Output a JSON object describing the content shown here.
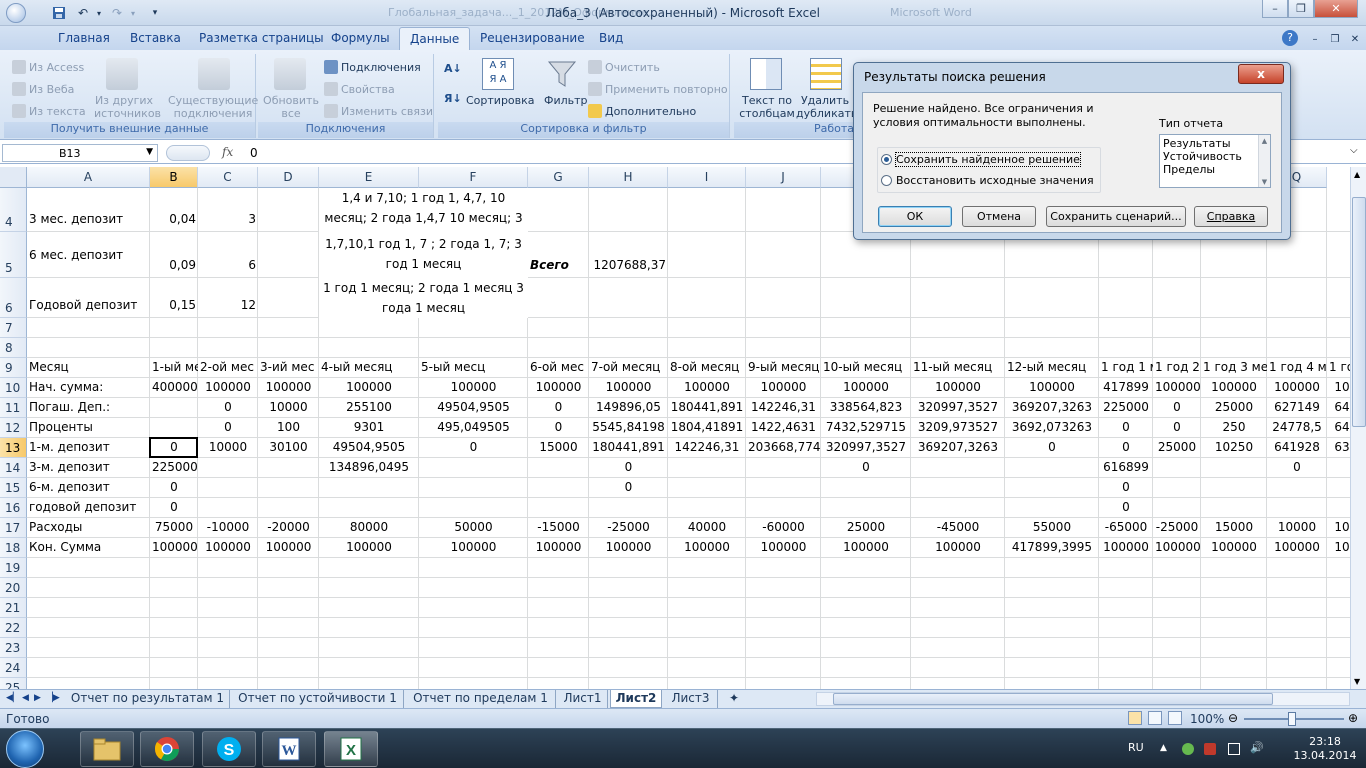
{
  "window": {
    "title": "Лаба_3 (Автосохраненный) - Microsoft Excel",
    "ghost_left": "Глобальная_задача..._1_2012М_Оформление...",
    "ghost_right": "Microsoft Word"
  },
  "ribbon": {
    "tabs": [
      "Главная",
      "Вставка",
      "Разметка страницы",
      "Формулы",
      "Данные",
      "Рецензирование",
      "Вид"
    ],
    "active_tab": "Данные",
    "groups": {
      "external": {
        "label": "Получить внешние данные",
        "from_access": "Из Access",
        "from_web": "Из Веба",
        "from_text": "Из текста",
        "from_other_1": "Из других",
        "from_other_2": "источников",
        "existing_1": "Существующие",
        "existing_2": "подключения"
      },
      "connections": {
        "label": "Подключения",
        "refresh_1": "Обновить",
        "refresh_2": "все",
        "connections": "Подключения",
        "properties": "Свойства",
        "edit_links": "Изменить связи"
      },
      "sort": {
        "label": "Сортировка и фильтр",
        "sort": "Сортировка",
        "filter": "Фильтр",
        "clear": "Очистить",
        "reapply": "Применить повторно",
        "advanced": "Дополнительно"
      },
      "tools": {
        "label": "Работа",
        "text_to_cols_1": "Текст по",
        "text_to_cols_2": "столбцам",
        "remove_dup_1": "Удалить",
        "remove_dup_2": "дубликаты"
      }
    }
  },
  "formula_bar": {
    "name_box": "B13",
    "fx": "fx",
    "value": "0"
  },
  "grid": {
    "columns": [
      "A",
      "B",
      "C",
      "D",
      "E",
      "F",
      "G",
      "H",
      "I",
      "J",
      "K",
      "L",
      "M",
      "N",
      "O",
      "P",
      "Q"
    ],
    "rows": [
      "4",
      "5",
      "6",
      "7",
      "8",
      "9",
      "10",
      "11",
      "12",
      "13",
      "14",
      "15",
      "16",
      "17",
      "18",
      "19",
      "20",
      "21",
      "22",
      "23",
      "24",
      "25"
    ],
    "top_notes": {
      "a4": "3 мес. депозит",
      "b4": "0,04",
      "c4": "3",
      "e4": "1,4 и 7,10; 1 год 1, 4,7, 10 месяц; 2 года 1,4,7 10 месяц; 3 года 1",
      "a5": "6 мес. депозит",
      "b5": "0,09",
      "c5": "6",
      "e5": "1,7,10,1 год 1, 7 ; 2 года 1, 7; 3 год 1 месяц",
      "g5": "Всего",
      "h5": "1207688,37",
      "a6": "Годовой депозит",
      "b6": "0,15",
      "c6": "12",
      "e6": "1 год 1 месяц; 2 года 1 месяц 3 года 1 месяц"
    },
    "table_rows": [
      [
        "Месяц",
        "1-ый мес",
        "2-ой мес",
        "3-ий мес",
        "4-ый месяц",
        "5-ый месц",
        "6-ой мес",
        "7-ой месяц",
        "8-ой месяц",
        "9-ый месяц",
        "10-ый месяц",
        "11-ый месяц",
        "12-ый месяц",
        "1 год 1 м",
        "1 год 2",
        "1 год 3 ме",
        "1 год 4 ме",
        "1 го"
      ],
      [
        "Нач. сумма:",
        "400000",
        "100000",
        "100000",
        "100000",
        "100000",
        "100000",
        "100000",
        "100000",
        "100000",
        "100000",
        "100000",
        "100000",
        "417899",
        "100000",
        "100000",
        "100000",
        "10"
      ],
      [
        "Погаш. Деп.:",
        "",
        "0",
        "10000",
        "255100",
        "49504,9505",
        "0",
        "149896,05",
        "180441,891",
        "142246,31",
        "338564,823",
        "320997,3527",
        "369207,3263",
        "225000",
        "0",
        "25000",
        "627149",
        "64"
      ],
      [
        "Проценты",
        "",
        "0",
        "100",
        "9301",
        "495,049505",
        "0",
        "5545,84198",
        "1804,41891",
        "1422,4631",
        "7432,529715",
        "3209,973527",
        "3692,073263",
        "0",
        "0",
        "250",
        "24778,5",
        "64"
      ],
      [
        "1-м. депозит",
        "0",
        "10000",
        "30100",
        "49504,9505",
        "0",
        "15000",
        "180441,891",
        "142246,31",
        "203668,774",
        "320997,3527",
        "369207,3263",
        "0",
        "0",
        "25000",
        "10250",
        "641928",
        "63"
      ],
      [
        "3-м. депозит",
        "225000",
        "",
        "",
        "134896,0495",
        "",
        "",
        "0",
        "",
        "",
        "0",
        "",
        "",
        "616899",
        "",
        "",
        "0",
        ""
      ],
      [
        "6-м. депозит",
        "0",
        "",
        "",
        "",
        "",
        "",
        "0",
        "",
        "",
        "",
        "",
        "",
        "0",
        "",
        "",
        "",
        ""
      ],
      [
        "годовой депозит",
        "0",
        "",
        "",
        "",
        "",
        "",
        "",
        "",
        "",
        "",
        "",
        "",
        "0",
        "",
        "",
        "",
        ""
      ],
      [
        "Расходы",
        "75000",
        "-10000",
        "-20000",
        "80000",
        "50000",
        "-15000",
        "-25000",
        "40000",
        "-60000",
        "25000",
        "-45000",
        "55000",
        "-65000",
        "-25000",
        "15000",
        "10000",
        "10"
      ],
      [
        "Кон. Сумма",
        "100000",
        "100000",
        "100000",
        "100000",
        "100000",
        "100000",
        "100000",
        "100000",
        "100000",
        "100000",
        "100000",
        "417899,3995",
        "100000",
        "100000",
        "100000",
        "100000",
        "10"
      ]
    ]
  },
  "sheets": {
    "tabs": [
      "Отчет по результатам 1",
      "Отчет по устойчивости 1",
      "Отчет по пределам 1",
      "Лист1",
      "Лист2",
      "Лист3"
    ],
    "active": "Лист2"
  },
  "status": {
    "ready": "Готово",
    "zoom": "100%"
  },
  "taskbar": {
    "lang": "RU",
    "time": "23:18",
    "date": "13.04.2014"
  },
  "dialog": {
    "title": "Результаты поиска решения",
    "close": "x",
    "message": "Решение найдено. Все ограничения и условия оптимальности выполнены.",
    "keep_solution": "Сохранить найденное решение",
    "restore_values": "Восстановить исходные значения",
    "report_type_label": "Тип отчета",
    "report_types": [
      "Результаты",
      "Устойчивость",
      "Пределы"
    ],
    "ok": "ОК",
    "cancel": "Отмена",
    "save_scenario": "Сохранить сценарий...",
    "help": "Справка"
  }
}
